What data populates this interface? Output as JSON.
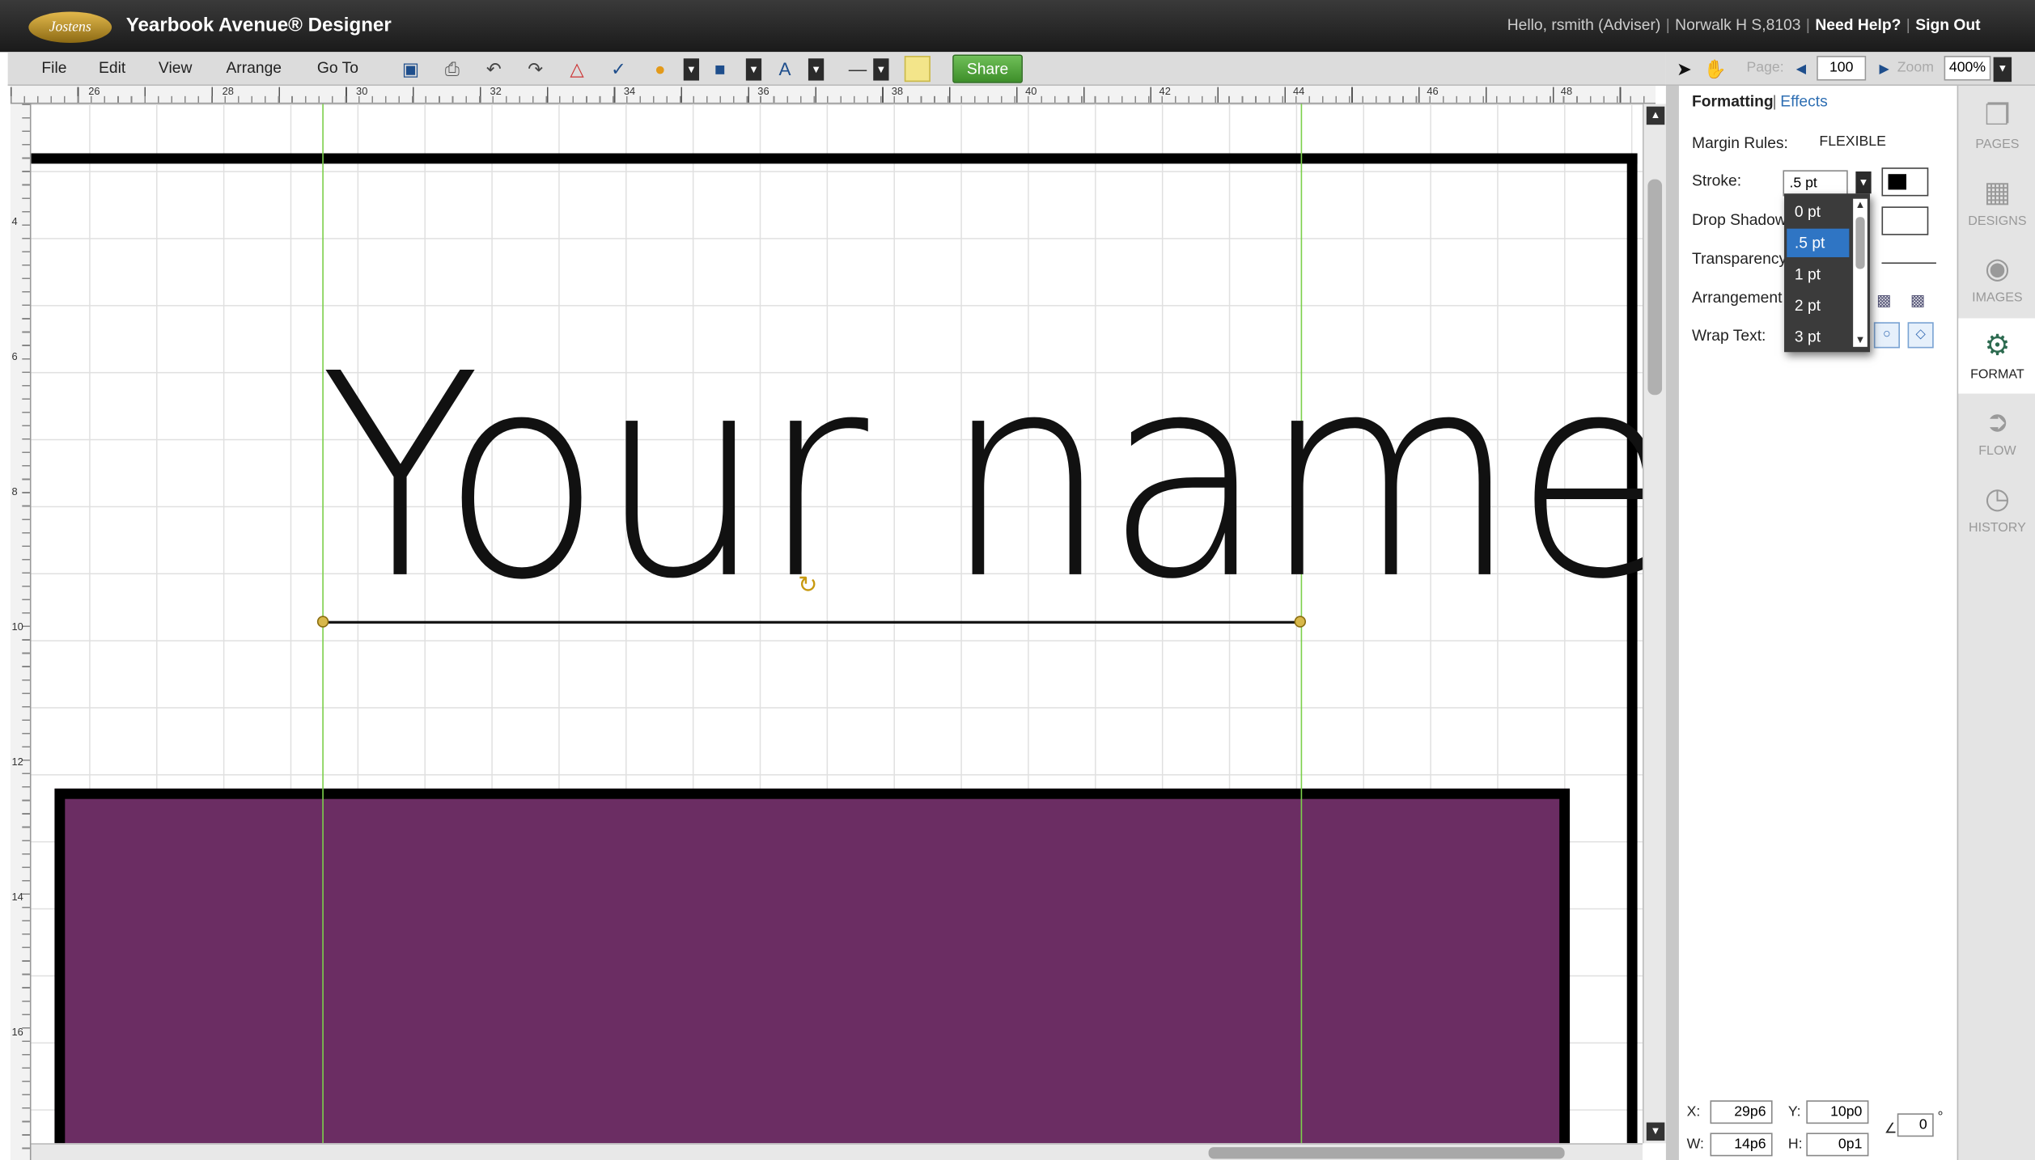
{
  "app": {
    "logo": "Jostens",
    "title": "Yearbook Avenue® Designer"
  },
  "user_links": {
    "greeting": "Hello, rsmith (Adviser)",
    "school": "Norwalk H S,8103",
    "help": "Need Help?",
    "signout": "Sign Out"
  },
  "menu": [
    "File",
    "Edit",
    "View",
    "Arrange",
    "Go To"
  ],
  "toolbar": {
    "share": "Share"
  },
  "nav": {
    "page_label": "Page:",
    "page_value": "100",
    "zoom_label": "Zoom",
    "zoom_value": "400%"
  },
  "ruler": {
    "h_ticks": [
      "26",
      "28",
      "30",
      "32",
      "34",
      "36",
      "38",
      "40",
      "42",
      "44",
      "46",
      "48"
    ],
    "v_ticks": [
      "4",
      "6",
      "8",
      "10",
      "12",
      "14",
      "16"
    ]
  },
  "canvas": {
    "text": "Your name"
  },
  "panel": {
    "tab_formatting": "Formatting",
    "tab_sep": "|",
    "tab_effects": "Effects",
    "margin_label": "Margin Rules:",
    "margin_value": "FLEXIBLE",
    "stroke_label": "Stroke:",
    "stroke_value": ".5 pt",
    "dropshadow_label": "Drop Shadow",
    "transparency_label": "Transparency",
    "arrangement_label": "Arrangement",
    "wrap_label": "Wrap Text:"
  },
  "stroke_options": [
    "0 pt",
    ".5 pt",
    "1 pt",
    "2 pt",
    "3 pt"
  ],
  "stroke_selected": ".5 pt",
  "coords": {
    "x_label": "X:",
    "x": "29p6",
    "y_label": "Y:",
    "y": "10p0",
    "w_label": "W:",
    "w": "14p6",
    "h_label": "H:",
    "h": "0p1",
    "angle": "0",
    "deg": "°"
  },
  "sidebar": [
    "PAGES",
    "DESIGNS",
    "IMAGES",
    "FORMAT",
    "FLOW",
    "HISTORY"
  ],
  "colors": {
    "accent_purple": "#6b2d63",
    "guide_green": "#7cd04b",
    "share_green": "#4fa53a",
    "selected_blue": "#2f75c4"
  }
}
